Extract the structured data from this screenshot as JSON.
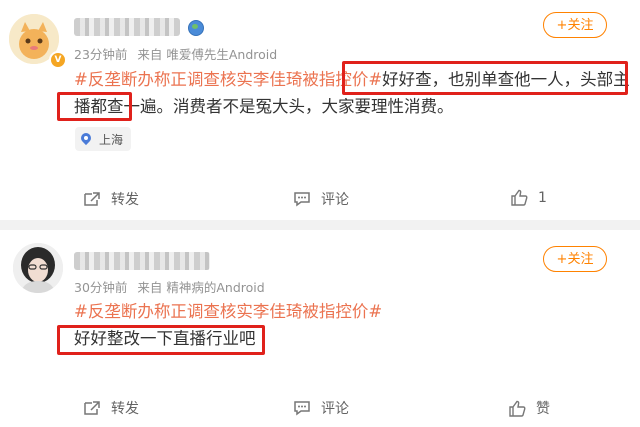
{
  "posts": [
    {
      "time": "23分钟前",
      "source": "来自 唯爱傅先生Android",
      "follow_label": "+关注",
      "hashtag": "#反垄断办称正调查核实李佳琦被指控价#",
      "text_part1": "好好查，也别单查他一人，头部主播都查一遍。",
      "text_part2": "消费者不是冤大头，大家要理性消费。",
      "location": "上海",
      "actions": {
        "forward": "转发",
        "comment": "评论",
        "like": "1"
      }
    },
    {
      "time": "30分钟前",
      "source": "来自 精神病的Android",
      "follow_label": "+关注",
      "hashtag": "#反垄断办称正调查核实李佳琦被指控价#",
      "text": "好好整改一下直播行业吧",
      "actions": {
        "forward": "转发",
        "comment": "评论",
        "like": "赞"
      }
    }
  ],
  "colors": {
    "accent": "#ff8200",
    "hashtag": "#eb7350",
    "highlight_box": "#e0211b"
  }
}
